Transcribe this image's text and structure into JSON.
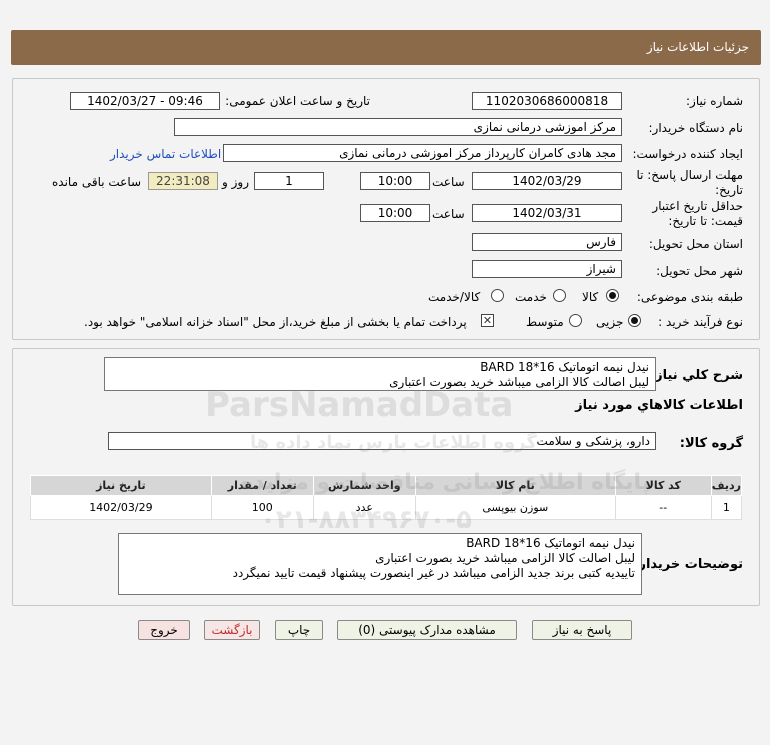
{
  "header": {
    "title": "جزئیات اطلاعات نیاز"
  },
  "form": {
    "need_number_label": "شماره نیاز:",
    "need_number": "1102030686000818",
    "announce_label": "تاریخ و ساعت اعلان عمومی:",
    "announce_value": "1402/03/27 - 09:46",
    "buyer_org_label": "نام دستگاه خریدار:",
    "buyer_org": "مرکز اموزشی درمانی نمازی",
    "requester_label": "ایجاد کننده درخواست:",
    "requester": "مجد هادی کامران کارپرداز مرکز اموزشی درمانی نمازی",
    "contact_link": "اطلاعات تماس خریدار",
    "deadline_label_1": "مهلت ارسال پاسخ: تا",
    "deadline_label_2": "تاریخ:",
    "deadline_date": "1402/03/29",
    "time_label": "ساعت",
    "deadline_time": "10:00",
    "days_value": "1",
    "days_label": "روز و",
    "remaining_value": "22:31:08",
    "remaining_label": "ساعت باقی مانده",
    "validity_label_1": "حداقل تاریخ اعتبار",
    "validity_label_2": "قیمت: تا تاریخ:",
    "validity_date": "1402/03/31",
    "validity_time": "10:00",
    "province_label": "استان محل تحویل:",
    "province": "فارس",
    "city_label": "شهر محل تحویل:",
    "city": "شیراز",
    "category_label": "طبقه بندی موضوعی:",
    "category_options": [
      "کالا",
      "خدمت",
      "کالا/خدمت"
    ],
    "process_label": "نوع فرآیند خرید :",
    "process_options": [
      "جزیی",
      "متوسط"
    ],
    "payment_note": "پرداخت تمام یا بخشی از مبلغ خرید،از محل \"اسناد خزانه اسلامی\" خواهد بود."
  },
  "summary": {
    "label": "شرح کلي نياز:",
    "text": "نیدل نیمه اتوماتیک BARD 18*16\nلیبل اصالت کالا الزامی میباشد  خرید بصورت اعتباری"
  },
  "goods": {
    "section_title": "اطلاعات کالاهاي مورد نياز",
    "group_label": "گروه کالا:",
    "group_value": "دارو، پزشکی و سلامت",
    "columns": [
      "ردیف",
      "کد کالا",
      "نام کالا",
      "واحد شمارش",
      "تعداد / مقدار",
      "تاریخ نیاز"
    ],
    "rows": [
      [
        "1",
        "--",
        "سوزن بیوپسی",
        "عدد",
        "100",
        "1402/03/29"
      ]
    ]
  },
  "buyer_notes": {
    "label": "توضیحات خریدار:",
    "text": "نیدل نیمه اتوماتیک BARD 18*16\nلیبل اصالت کالا الزامی میباشد  خرید بصورت اعتباری\nتاییدیه کتبی برند جدید الزامی میباشد در غیر اینصورت پیشنهاد قیمت تایید نمیگردد"
  },
  "buttons": {
    "reply": "پاسخ به نیاز",
    "attachments": "مشاهده مدارک پیوستی (0)",
    "print": "چاپ",
    "back": "بازگشت",
    "exit": "خروج"
  },
  "watermark": {
    "brand": "ParsNamadData",
    "line1": "پایگاه اطلاع رسانی مناقصات و مزایده",
    "phone": "۰۲۱-۸۸۳۴۹۶۷۰-۵",
    "line2": "گروه اطلاعات پارس نماد داده ها"
  }
}
